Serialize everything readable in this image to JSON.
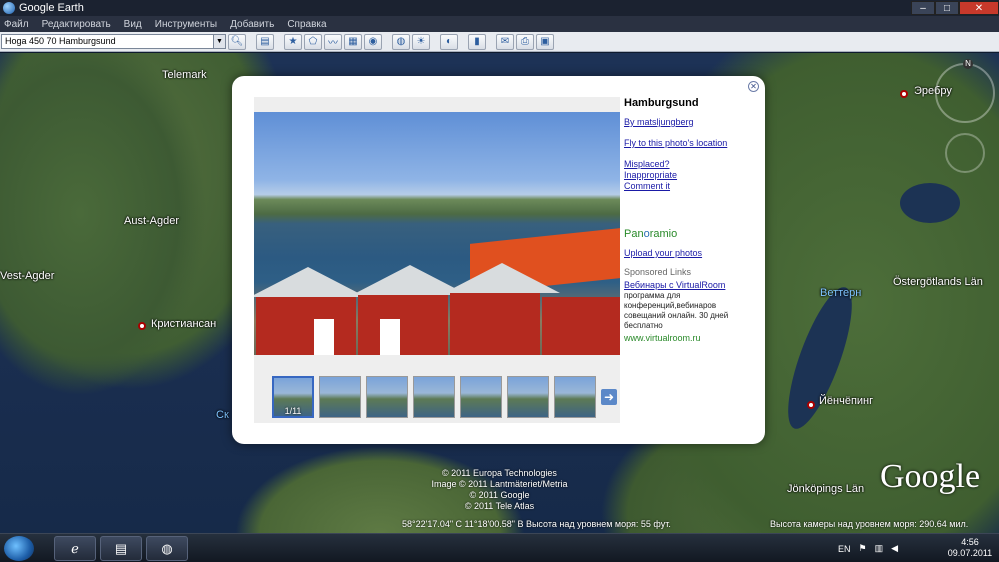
{
  "window": {
    "title": "Google Earth"
  },
  "menu": [
    "Файл",
    "Редактировать",
    "Вид",
    "Инструменты",
    "Добавить",
    "Справка"
  ],
  "search": {
    "value": "Hoga   450 70 Hamburgsund"
  },
  "toolbar_icons": [
    "sidebar-icon",
    "placemark-icon",
    "polygon-icon",
    "path-icon",
    "image-overlay-icon",
    "tour-icon",
    "sky-icon",
    "sun-icon",
    "planet-icon",
    "ruler-icon",
    "email-icon",
    "print-icon",
    "maps-icon"
  ],
  "map": {
    "labels": [
      {
        "id": "telemark",
        "text": "Telemark"
      },
      {
        "id": "aust-agder",
        "text": "Aust-Agder"
      },
      {
        "id": "vest-agder",
        "text": "Vest-Agder"
      },
      {
        "id": "kristiansand",
        "text": "Кристиансан"
      },
      {
        "id": "orebro",
        "text": "Эребру"
      },
      {
        "id": "vettern",
        "text": "Веттерн"
      },
      {
        "id": "ostergotland",
        "text": "Östergötlands Län"
      },
      {
        "id": "jonkoping",
        "text": "Йёнчёпинг"
      },
      {
        "id": "jonkopings-lan",
        "text": "Jönköpings Län"
      },
      {
        "id": "sk",
        "text": "Ск"
      }
    ],
    "credits": [
      "© 2011 Europa Technologies",
      "Image © 2011 Lantmäteriet/Metria",
      "© 2011 Google",
      "© 2011 Tele Atlas"
    ],
    "logo": "Google",
    "compass_n": "N",
    "status": {
      "coords": "58°22'17.04\" С   11°18'00.58\" В  Высота над уровнем моря:    55 фут.",
      "camera": "Высота камеры над уровнем моря:   290.64 мил."
    }
  },
  "popup": {
    "place": "Hamburgsund",
    "author_link": "By matsljungberg",
    "fly_link": "Fly to this photo's location",
    "misplaced": "Misplaced?",
    "inappropriate": "Inappropriate",
    "comment": "Comment it",
    "panoramio_pre": "Pan",
    "panoramio_o": "o",
    "panoramio_post": "ramio",
    "upload_link": "Upload your photos",
    "sponsored": "Sponsored Links",
    "ad_title": "Вебинары с VirtualRoom",
    "ad_text": "программа для конференций,вебинаров совещаний онлайн. 30 дней бесплатно",
    "ad_url": "www.virtualroom.ru",
    "photo_counter": "1/11",
    "thumb_count": 7
  },
  "taskbar": {
    "lang": "EN",
    "time": "4:56",
    "date": "09.07.2011"
  }
}
